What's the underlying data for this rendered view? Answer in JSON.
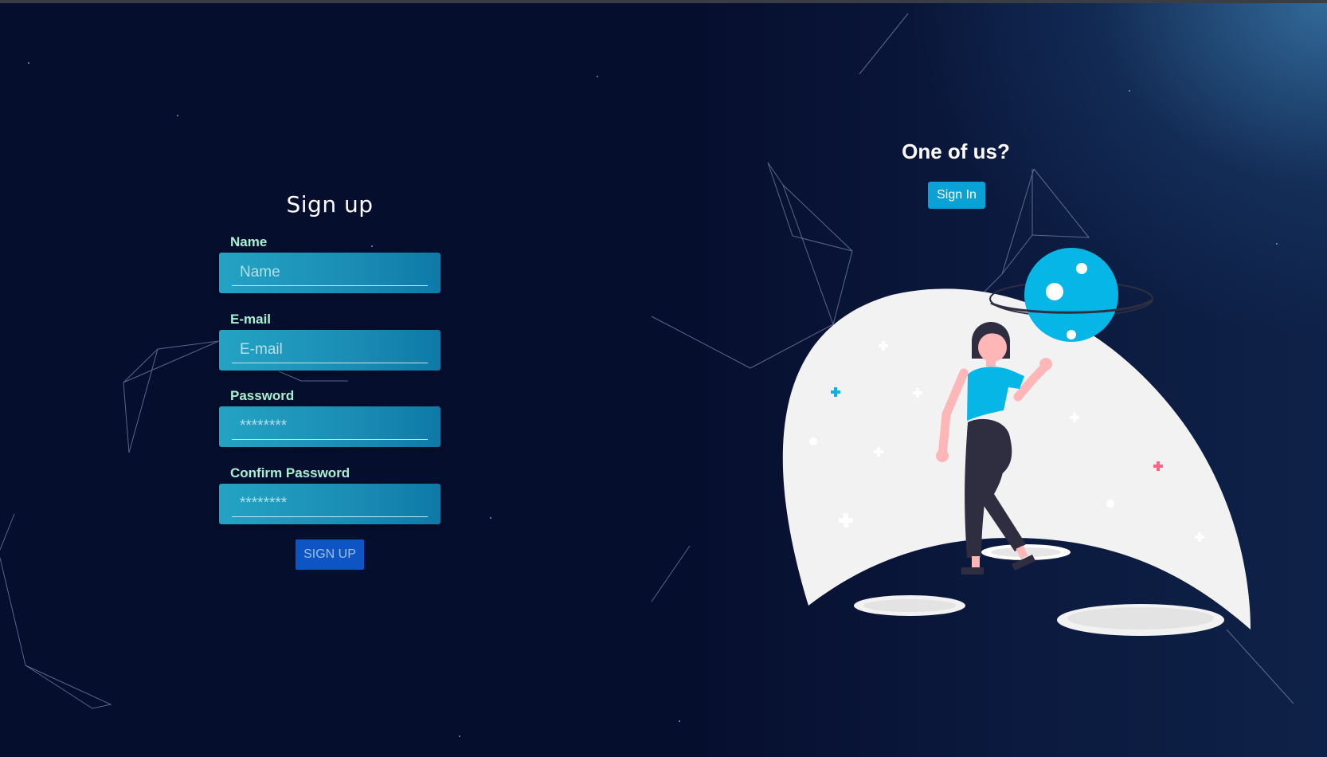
{
  "signup": {
    "title": "Sign up",
    "fields": [
      {
        "label": "Name",
        "placeholder": "Name",
        "type": "text"
      },
      {
        "label": "E-mail",
        "placeholder": "E-mail",
        "type": "email"
      },
      {
        "label": "Password",
        "placeholder": "********",
        "type": "password"
      },
      {
        "label": "Confirm Password",
        "placeholder": "********",
        "type": "password"
      }
    ],
    "submit_label": "SIGN UP"
  },
  "signin": {
    "heading": "One of us?",
    "button_label": "Sign In"
  },
  "illustration": {
    "icon": "astronaut-girl-planet-illustration",
    "colors": {
      "moon": "#f2f2f2",
      "planet": "#06b6e6",
      "shirt": "#06b6e6",
      "pants": "#2f2e41",
      "skin": "#ffb6b6",
      "accent_red": "#ff6584"
    }
  },
  "theme": {
    "background": "#060e2e",
    "field_gradient_start": "#24a3c3",
    "field_gradient_end": "#0e79a7",
    "label_color": "#a8f0d2",
    "signup_button": "#0d55c4",
    "signin_button": "#08a2d6"
  }
}
